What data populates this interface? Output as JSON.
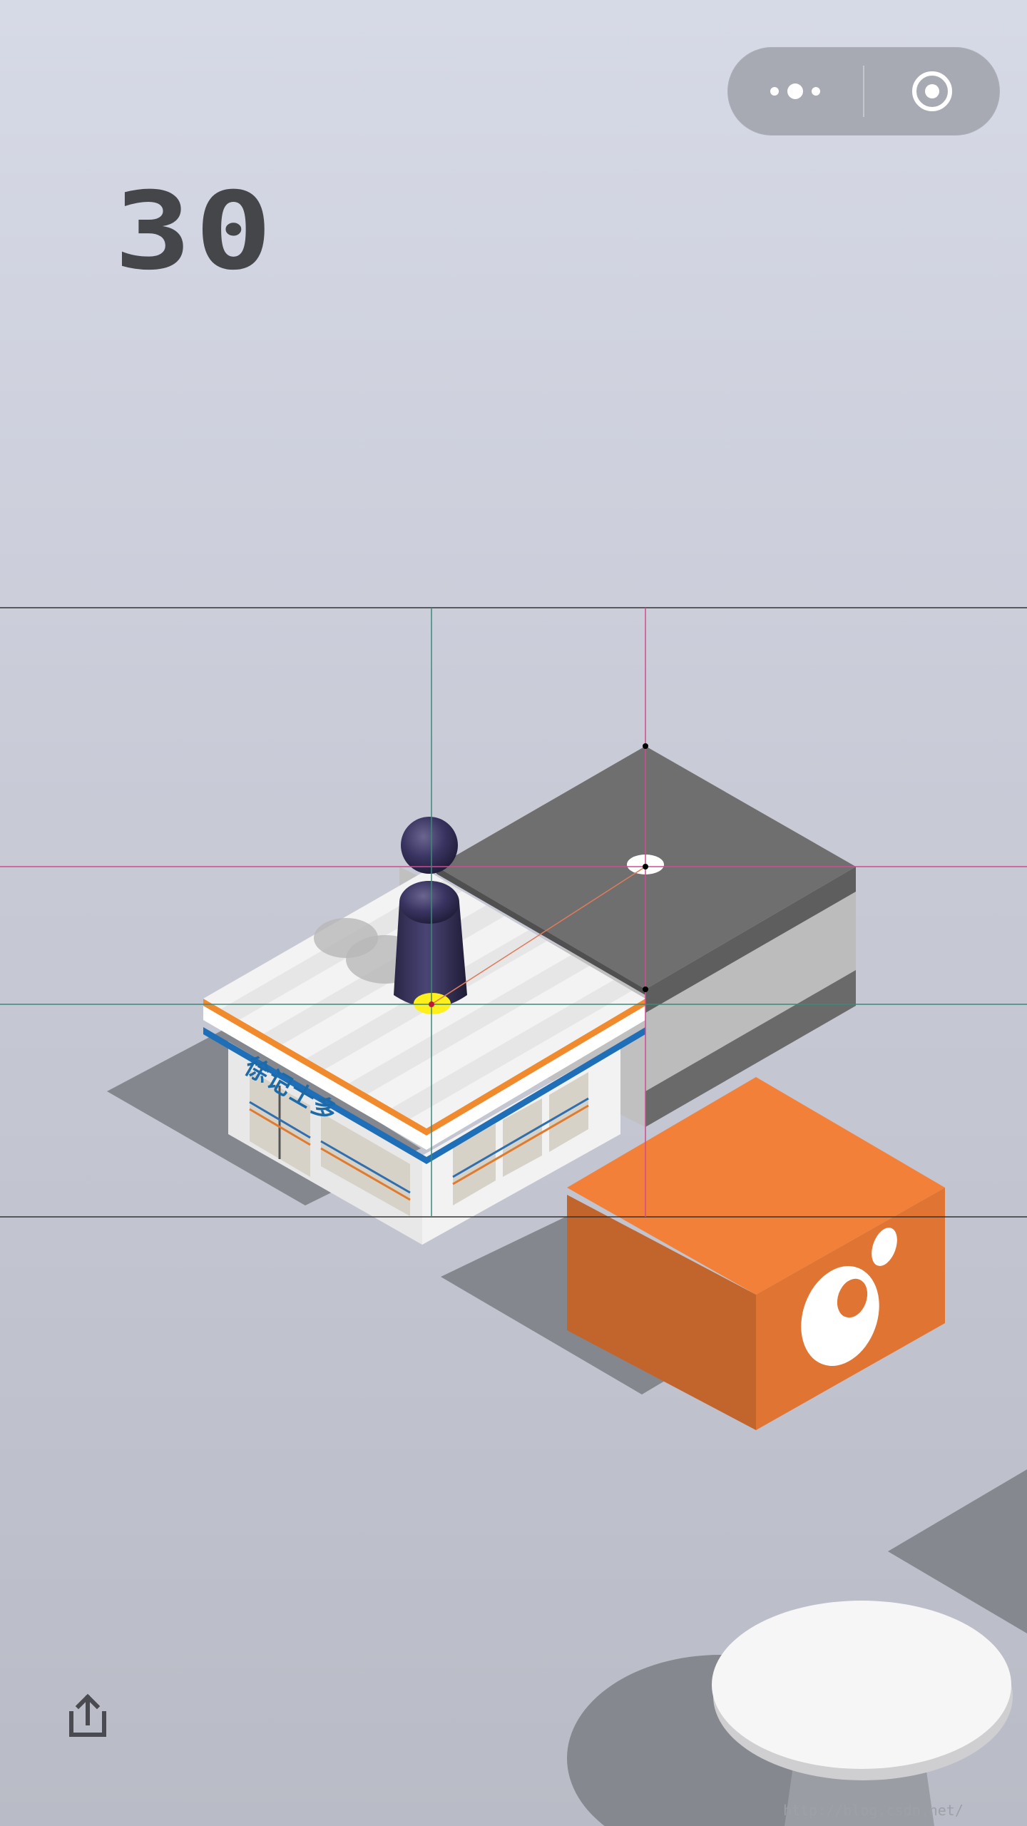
{
  "game": {
    "score": "30",
    "store_sign": "徐记士多",
    "watermark": "http://blog.csdn.net/"
  },
  "capsule_menu": {
    "more_icon": "more-dots-icon",
    "close_icon": "target-close-icon"
  },
  "share": {
    "icon": "share-upload-icon"
  },
  "colors": {
    "background_top": "#d6dae6",
    "background_bottom": "#b9bbc6",
    "score_text": "#45464a",
    "orange_block": "#f28039",
    "gray_block_top": "#707070",
    "player": "#2f2b4f",
    "guide_line_magenta": "#d14b8f",
    "guide_line_teal": "#3b8a7a",
    "guide_line_dark": "#333333"
  }
}
